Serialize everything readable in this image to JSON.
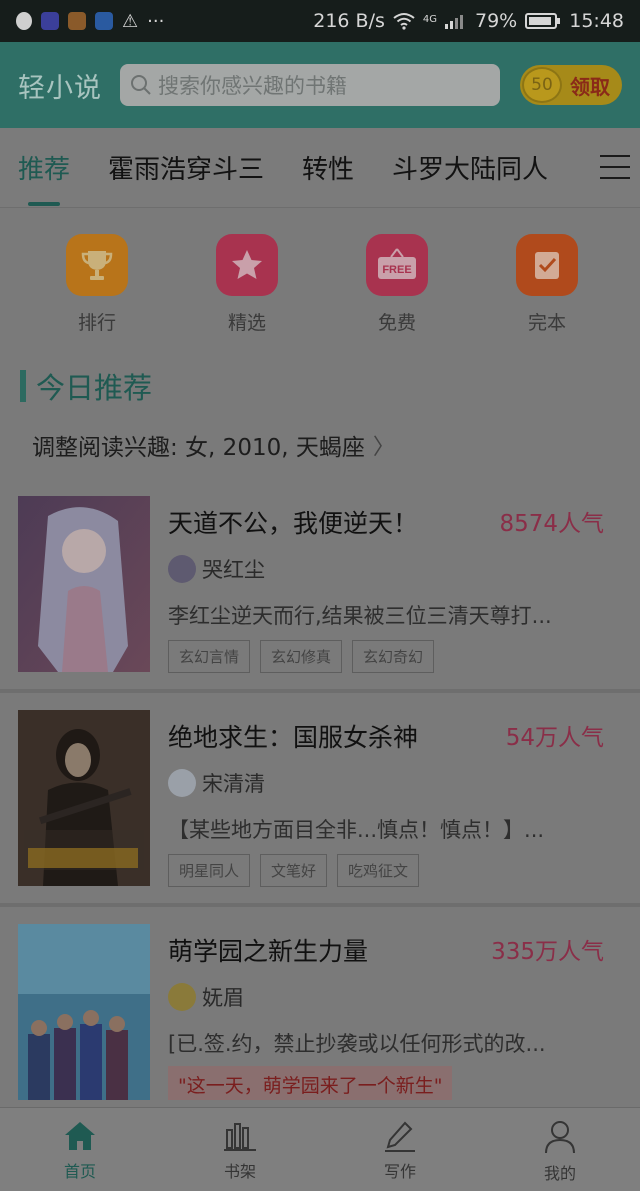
{
  "status_bar": {
    "net_speed": "216 B/s",
    "network": "4G",
    "battery": "79%",
    "time": "15:48",
    "left_icons": [
      "qq-icon",
      "app-icon",
      "game-icon",
      "remote-icon",
      "warning-icon",
      "more-icon"
    ]
  },
  "header": {
    "logo": "轻小说",
    "search_placeholder": "搜索你感兴趣的书籍",
    "coin_count": "50",
    "reward_label": "领取"
  },
  "tabs": [
    {
      "label": "推荐",
      "active": true
    },
    {
      "label": "霍雨浩穿斗三",
      "active": false
    },
    {
      "label": "转性",
      "active": false
    },
    {
      "label": "斗罗大陆同人",
      "active": false
    }
  ],
  "quick_entries": [
    {
      "label": "排行",
      "icon": "trophy-icon",
      "color": "#b8741a"
    },
    {
      "label": "精选",
      "icon": "star-icon",
      "color": "#a8334f"
    },
    {
      "label": "免费",
      "icon": "free-tag-icon",
      "color": "#a8334f"
    },
    {
      "label": "完本",
      "icon": "check-book-icon",
      "color": "#b04a1c"
    }
  ],
  "section": {
    "title": "今日推荐",
    "interest": "调整阅读兴趣: 女, 2010, 天蝎座"
  },
  "books": [
    {
      "title": "天道不公，我便逆天！",
      "popularity": "8574人气",
      "author": "哭红尘",
      "desc": "李红尘逆天而行,结果被三位三清天尊打...",
      "tags": [
        "玄幻言情",
        "玄幻修真",
        "玄幻奇幻"
      ]
    },
    {
      "title": "绝地求生：国服女杀神",
      "popularity": "54万人气",
      "author": "宋清清",
      "desc": "【某些地方面目全非...慎点！慎点！】...",
      "tags": [
        "明星同人",
        "文笔好",
        "吃鸡征文"
      ]
    },
    {
      "title": "萌学园之新生力量",
      "popularity": "335万人气",
      "author": "妩眉",
      "desc": "[已.签.约，禁止抄袭或以任何形式的改...",
      "notice": "\"这一天，萌学园来了一个新生\""
    }
  ],
  "bottom_nav": [
    {
      "label": "首页",
      "icon": "home-icon",
      "active": true
    },
    {
      "label": "书架",
      "icon": "bookshelf-icon",
      "active": false
    },
    {
      "label": "写作",
      "icon": "pen-icon",
      "active": false
    },
    {
      "label": "我的",
      "icon": "user-icon",
      "active": false
    }
  ],
  "colors": {
    "accent": "#1f5a52",
    "header_bg": "#2f6f66",
    "popularity": "#8a2e48"
  }
}
